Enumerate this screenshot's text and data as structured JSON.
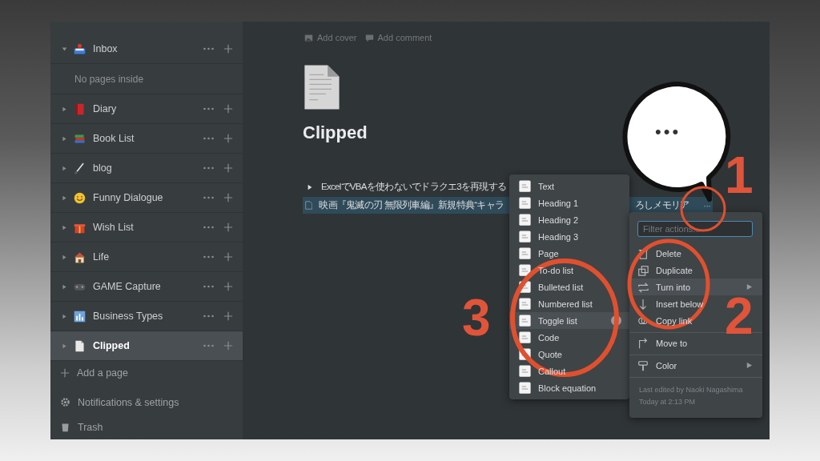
{
  "sidebar": {
    "pages": [
      {
        "title": "Inbox",
        "expanded": true,
        "selected": false,
        "empty_note": "No pages inside"
      },
      {
        "title": "Diary",
        "expanded": false,
        "selected": false
      },
      {
        "title": "Book List",
        "expanded": false,
        "selected": false
      },
      {
        "title": "blog",
        "expanded": false,
        "selected": false
      },
      {
        "title": "Funny Dialogue",
        "expanded": false,
        "selected": false
      },
      {
        "title": "Wish List",
        "expanded": false,
        "selected": false
      },
      {
        "title": "Life",
        "expanded": false,
        "selected": false
      },
      {
        "title": "GAME Capture",
        "expanded": false,
        "selected": false
      },
      {
        "title": "Business Types",
        "expanded": false,
        "selected": false
      },
      {
        "title": "Clipped",
        "expanded": false,
        "selected": true
      }
    ],
    "add_page": "Add a page",
    "footer": [
      {
        "kind": "settings",
        "label": "Notifications & settings"
      },
      {
        "kind": "trash",
        "label": "Trash"
      }
    ]
  },
  "page": {
    "toolbar": [
      "Add cover",
      "Add comment"
    ],
    "title": "Clipped",
    "blocks": [
      {
        "kind": "toggle",
        "selected": false,
        "text": "ExcelでVBAを使わないでドラクエ3を再現する"
      },
      {
        "kind": "page",
        "selected": true,
        "text": "映画『鬼滅の刃 無限列車編』新規特典“キャラ",
        "text_tail": "ろしメモリア",
        "more": "···"
      }
    ]
  },
  "turn_into_menu": {
    "items": [
      {
        "label": "Text",
        "selected": false
      },
      {
        "label": "Heading 1",
        "selected": false
      },
      {
        "label": "Heading 2",
        "selected": false
      },
      {
        "label": "Heading 3",
        "selected": false
      },
      {
        "label": "Page",
        "selected": false
      },
      {
        "label": "To-do list",
        "selected": false
      },
      {
        "label": "Bulleted list",
        "selected": false
      },
      {
        "label": "Numbered list",
        "selected": false
      },
      {
        "label": "Toggle list",
        "selected": true
      },
      {
        "label": "Code",
        "selected": false
      },
      {
        "label": "Quote",
        "selected": false
      },
      {
        "label": "Callout",
        "selected": false
      },
      {
        "label": "Block equation",
        "selected": false
      }
    ]
  },
  "action_menu": {
    "filter": {
      "placeholder": "Filter actions..."
    },
    "groups": [
      [
        {
          "label": "Delete",
          "selected": false,
          "submenu": false
        },
        {
          "label": "Duplicate",
          "selected": false,
          "submenu": false
        },
        {
          "label": "Turn into",
          "selected": true,
          "submenu": true
        },
        {
          "label": "Insert below",
          "selected": false,
          "submenu": false
        },
        {
          "label": "Copy link",
          "selected": false,
          "submenu": false
        }
      ],
      [
        {
          "label": "Move to",
          "selected": false,
          "submenu": false
        }
      ],
      [
        {
          "label": "Color",
          "selected": false,
          "submenu": true
        }
      ]
    ],
    "footer": [
      "Last edited by Naoki Nagashima",
      "Today at 2:13 PM"
    ]
  },
  "annotations": {
    "callout": "•••",
    "steps": [
      "1",
      "2",
      "3"
    ]
  }
}
